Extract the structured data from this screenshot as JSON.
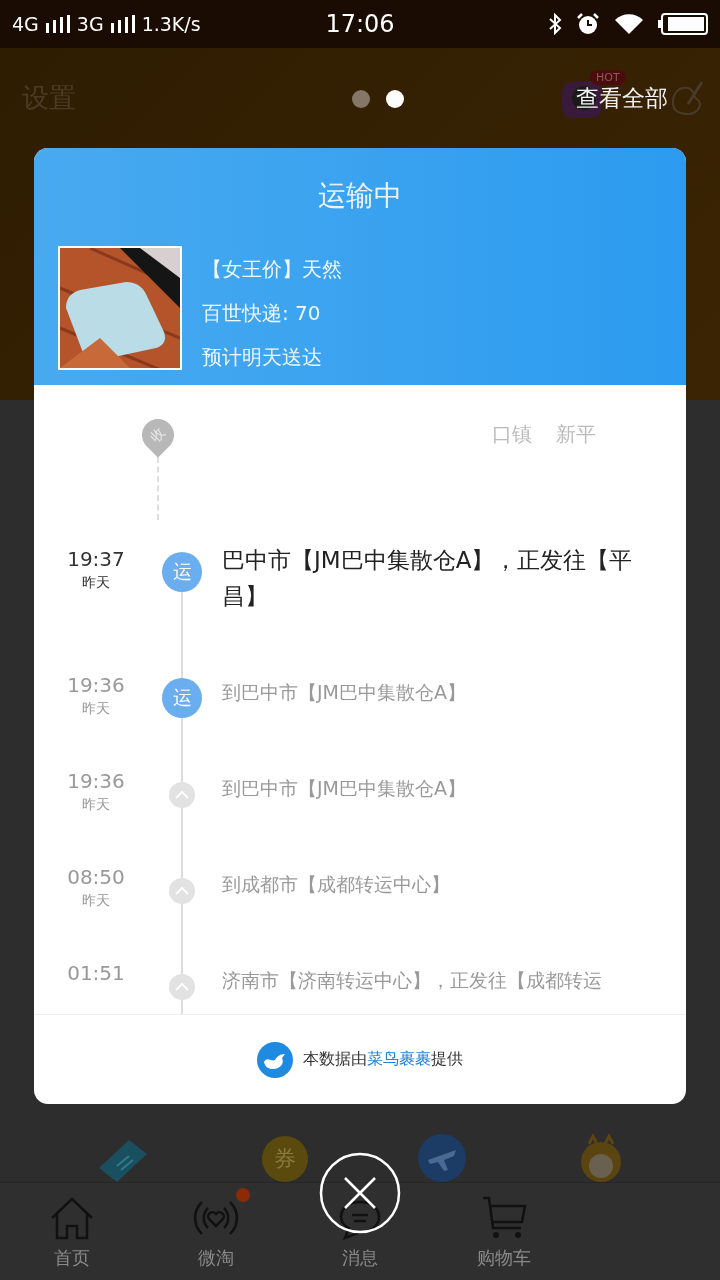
{
  "status_bar": {
    "network_1": "4G",
    "network_2": "3G",
    "speed": "1.3K/s",
    "time": "17:06"
  },
  "background": {
    "settings": "设置",
    "page_dots": [
      {
        "selected": false
      },
      {
        "selected": true
      }
    ],
    "hot_badge": "HOT",
    "view_all": "查看全部",
    "shortcut_icons": [
      {
        "kind": "ticket"
      },
      {
        "kind": "coupon",
        "label": "券"
      },
      {
        "kind": "plane"
      },
      {
        "kind": "mascot"
      }
    ]
  },
  "modal": {
    "title": "运输中",
    "product_title": "【女王价】天然",
    "courier": "百世快递: 70",
    "eta": "预计明天送达",
    "pin_label": "收",
    "address": [
      "口镇",
      "新平"
    ],
    "events": [
      {
        "time": "19:37",
        "date": "昨天",
        "text": "巴中市【JM巴中集散仓A】，正发往【平昌】",
        "current": true,
        "kind": "badge",
        "badge_text": "运"
      },
      {
        "time": "19:36",
        "date": "昨天",
        "text": "到巴中市【JM巴中集散仓A】",
        "current": false,
        "kind": "badge",
        "badge_text": "运"
      },
      {
        "time": "19:36",
        "date": "昨天",
        "text": "到巴中市【JM巴中集散仓A】",
        "current": false,
        "kind": "chevron"
      },
      {
        "time": "08:50",
        "date": "昨天",
        "text": "到成都市【成都转运中心】",
        "current": false,
        "kind": "chevron"
      },
      {
        "time": "01:51",
        "text": "济南市【济南转运中心】，正发往【成都转运",
        "current": false,
        "kind": "chevron"
      }
    ],
    "footer": {
      "before": "本数据由",
      "link": "菜鸟裹裹",
      "after": "提供"
    }
  },
  "tab_bar": [
    {
      "label": "首页",
      "kind": "home",
      "badge": false
    },
    {
      "label": "微淘",
      "kind": "heart-signal",
      "badge": true
    },
    {
      "label": "消息",
      "kind": "chat",
      "badge": false
    },
    {
      "label": "购物车",
      "kind": "cart",
      "badge": false
    }
  ]
}
